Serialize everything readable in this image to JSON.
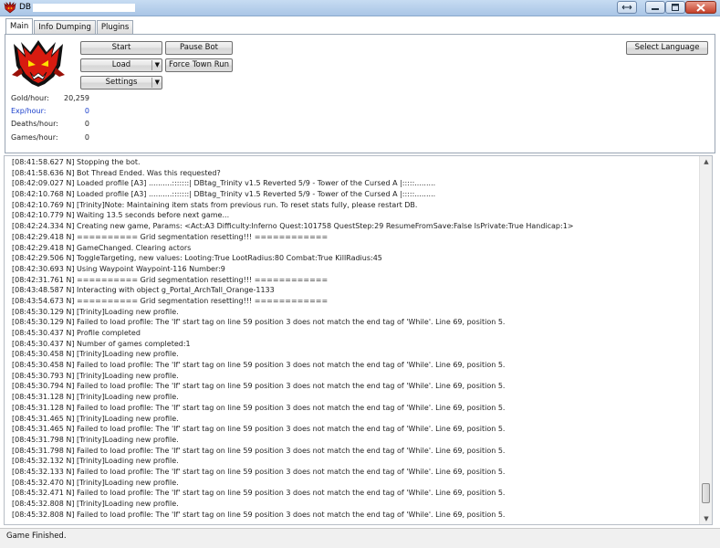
{
  "window": {
    "title": "DB -",
    "controls": {
      "minimize_icon": "minimize-icon",
      "maximize_icon": "maximize-icon",
      "close_icon": "close-icon"
    }
  },
  "tabs": [
    {
      "label": "Main",
      "active": true
    },
    {
      "label": "Info Dumping",
      "active": false
    },
    {
      "label": "Plugins",
      "active": false
    }
  ],
  "buttons": {
    "start": "Start",
    "pause_bot": "Pause Bot",
    "load": "Load",
    "force_town_run": "Force Town Run",
    "settings": "Settings",
    "select_language": "Select Language"
  },
  "stats": [
    {
      "label": "Gold/hour:",
      "value": "20,259",
      "highlight": false
    },
    {
      "label": "Exp/hour:",
      "value": "0",
      "highlight": true
    },
    {
      "label": "Deaths/hour:",
      "value": "0",
      "highlight": false
    },
    {
      "label": "Games/hour:",
      "value": "0",
      "highlight": false
    }
  ],
  "log": [
    "[08:41:58.627 N] Stopping the bot.",
    "[08:41:58.636 N] Bot Thread Ended. Was this requested?",
    "[08:42:09.027 N] Loaded profile [A3] ..........:::::::| DBtag_Trinity v1.5 Reverted 5/9 - Tower of the Cursed A |:::::.........",
    "[08:42:10.768 N] Loaded profile [A3] ..........:::::::| DBtag_Trinity v1.5 Reverted 5/9 - Tower of the Cursed A |:::::.........",
    "[08:42:10.769 N] [Trinity]Note: Maintaining item stats from previous run. To reset stats fully, please restart DB.",
    "[08:42:10.779 N] Waiting 13.5 seconds before next game...",
    "[08:42:24.334 N] Creating new game, Params: <Act:A3 Difficulty:Inferno Quest:101758 QuestStep:29 ResumeFromSave:False IsPrivate:True Handicap:1>",
    "[08:42:29.418 N] ========== Grid segmentation resetting!!! ============",
    "[08:42:29.418 N] GameChanged. Clearing actors",
    "[08:42:29.506 N] ToggleTargeting, new values: Looting:True LootRadius:80 Combat:True KillRadius:45",
    "[08:42:30.693 N] Using Waypoint Waypoint-116 Number:9",
    "[08:42:31.761 N] ========== Grid segmentation resetting!!! ============",
    "[08:43:48.587 N] Interacting with object g_Portal_ArchTall_Orange-1133",
    "[08:43:54.673 N] ========== Grid segmentation resetting!!! ============",
    "[08:45:30.129 N] [Trinity]Loading new profile.",
    "[08:45:30.129 N] Failed to load profile: The 'If' start tag on line 59 position 3 does not match the end tag of 'While'. Line 69, position 5.",
    "[08:45:30.437 N] Profile completed",
    "[08:45:30.437 N] Number of games completed:1",
    "[08:45:30.458 N] [Trinity]Loading new profile.",
    "[08:45:30.458 N] Failed to load profile: The 'If' start tag on line 59 position 3 does not match the end tag of 'While'. Line 69, position 5.",
    "[08:45:30.793 N] [Trinity]Loading new profile.",
    "[08:45:30.794 N] Failed to load profile: The 'If' start tag on line 59 position 3 does not match the end tag of 'While'. Line 69, position 5.",
    "[08:45:31.128 N] [Trinity]Loading new profile.",
    "[08:45:31.128 N] Failed to load profile: The 'If' start tag on line 59 position 3 does not match the end tag of 'While'. Line 69, position 5.",
    "[08:45:31.465 N] [Trinity]Loading new profile.",
    "[08:45:31.465 N] Failed to load profile: The 'If' start tag on line 59 position 3 does not match the end tag of 'While'. Line 69, position 5.",
    "[08:45:31.798 N] [Trinity]Loading new profile.",
    "[08:45:31.798 N] Failed to load profile: The 'If' start tag on line 59 position 3 does not match the end tag of 'While'. Line 69, position 5.",
    "[08:45:32.132 N] [Trinity]Loading new profile.",
    "[08:45:32.133 N] Failed to load profile: The 'If' start tag on line 59 position 3 does not match the end tag of 'While'. Line 69, position 5.",
    "[08:45:32.470 N] [Trinity]Loading new profile.",
    "[08:45:32.471 N] Failed to load profile: The 'If' start tag on line 59 position 3 does not match the end tag of 'While'. Line 69, position 5.",
    "[08:45:32.808 N] [Trinity]Loading new profile.",
    "[08:45:32.808 N] Failed to load profile: The 'If' start tag on line 59 position 3 does not match the end tag of 'While'. Line 69, position 5."
  ],
  "status": "Game Finished.",
  "colors": {
    "stat_highlight": "#1a3fcc",
    "titlebar": "#a9c5e6",
    "close_button": "#c4402a"
  }
}
